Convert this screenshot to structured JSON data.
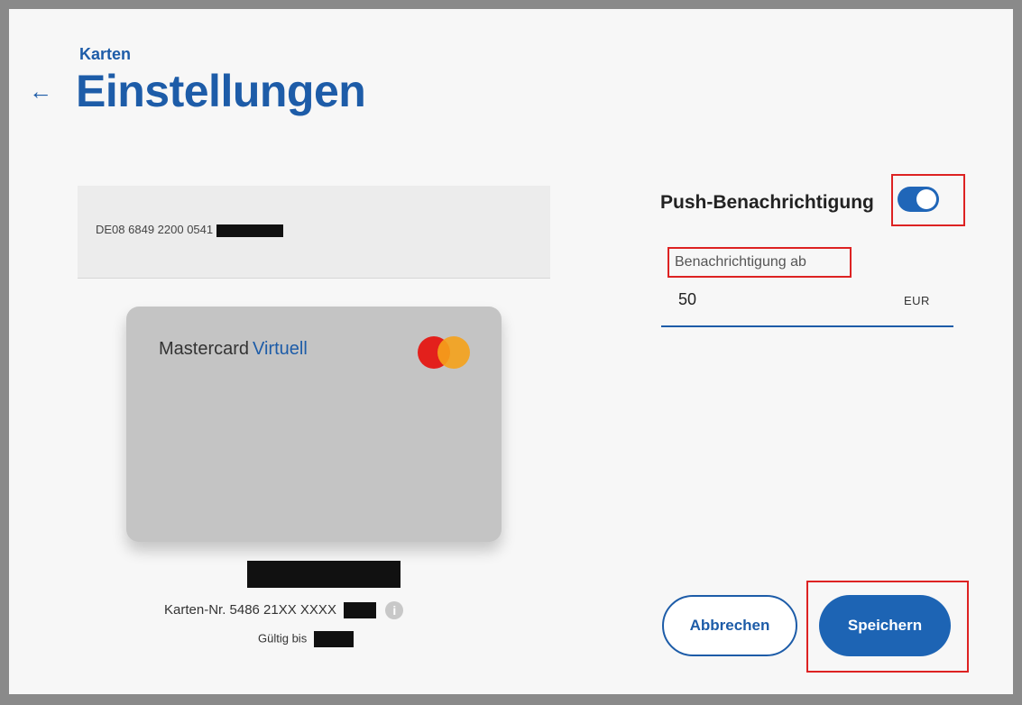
{
  "header": {
    "breadcrumb": "Karten",
    "back_icon": "arrow-left-icon",
    "title": "Einstellungen"
  },
  "account": {
    "iban_visible": "DE08 6849 2200 0541"
  },
  "card": {
    "brand": "Mastercard",
    "type": "Virtuell",
    "logo": "mastercard-logo",
    "number_label": "Karten-Nr. 5486 21XX XXXX",
    "valid_label": "Gültig bis",
    "info_icon": "info-icon"
  },
  "notification": {
    "label": "Push-Benachrichtigung",
    "enabled": true,
    "threshold_label": "Benachrichtigung ab",
    "threshold_value": "50",
    "currency": "EUR"
  },
  "actions": {
    "cancel_label": "Abbrechen",
    "save_label": "Speichern"
  },
  "colors": {
    "accent": "#1d5ca8",
    "highlight": "#dd2222"
  }
}
